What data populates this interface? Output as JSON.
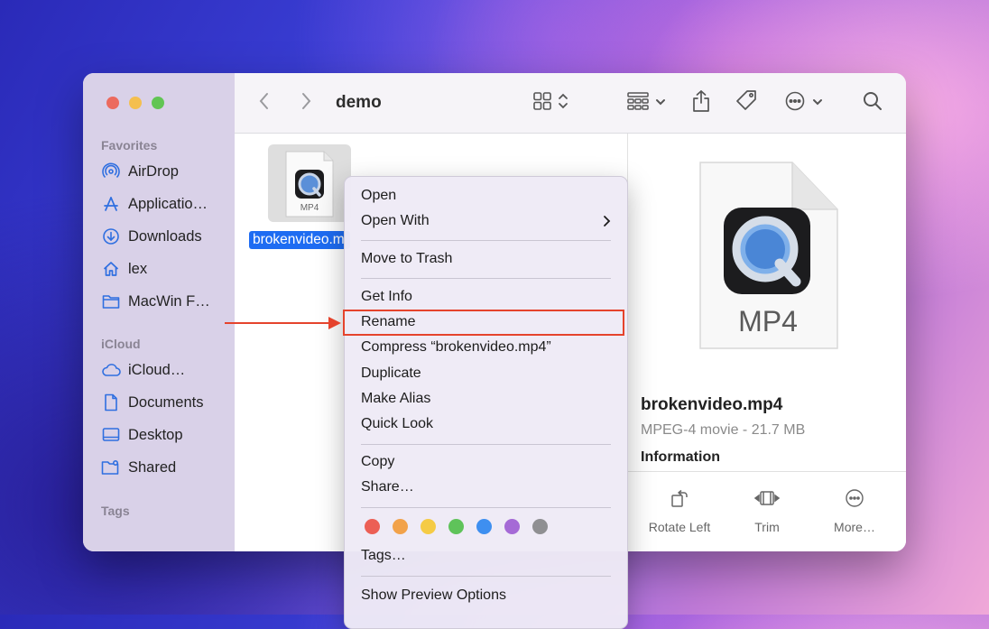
{
  "window": {
    "title": "demo"
  },
  "sidebar": {
    "sections": [
      {
        "heading": "Favorites",
        "items": [
          {
            "label": "AirDrop",
            "icon": "airdrop-icon"
          },
          {
            "label": "Applicatio…",
            "icon": "applications-icon"
          },
          {
            "label": "Downloads",
            "icon": "downloads-icon"
          },
          {
            "label": "lex",
            "icon": "home-icon"
          },
          {
            "label": "MacWin F…",
            "icon": "folder-icon"
          }
        ]
      },
      {
        "heading": "iCloud",
        "items": [
          {
            "label": "iCloud…",
            "icon": "cloud-icon"
          },
          {
            "label": "Documents",
            "icon": "document-icon"
          },
          {
            "label": "Desktop",
            "icon": "desktop-icon"
          },
          {
            "label": "Shared",
            "icon": "shared-folder-icon"
          }
        ]
      },
      {
        "heading": "Tags",
        "items": []
      }
    ]
  },
  "file": {
    "name": "brokenvideo.mp4",
    "display_name": "brokenvideo.m",
    "badge": "MP4"
  },
  "context_menu": {
    "groups": [
      [
        "Open",
        "Open With"
      ],
      [
        "Move to Trash"
      ],
      [
        "Get Info",
        "Rename",
        "Compress “brokenvideo.mp4”",
        "Duplicate",
        "Make Alias",
        "Quick Look"
      ],
      [
        "Copy",
        "Share…"
      ],
      [
        "Tags…"
      ],
      [
        "Show Preview Options"
      ]
    ],
    "tag_colors": [
      "#ec5f55",
      "#f2a24a",
      "#f5cb45",
      "#5fc35a",
      "#3e8ff0",
      "#a56ad6",
      "#8f8f92"
    ],
    "highlighted_item": "Rename"
  },
  "preview": {
    "badge": "MP4",
    "file_name": "brokenvideo.mp4",
    "kind": "MPEG-4 movie - 21.7 MB",
    "info_heading": "Information",
    "actions": [
      "Rotate Left",
      "Trim",
      "More…"
    ]
  },
  "colors": {
    "accent": "#1e6cf2",
    "annotation": "#e5432c"
  }
}
